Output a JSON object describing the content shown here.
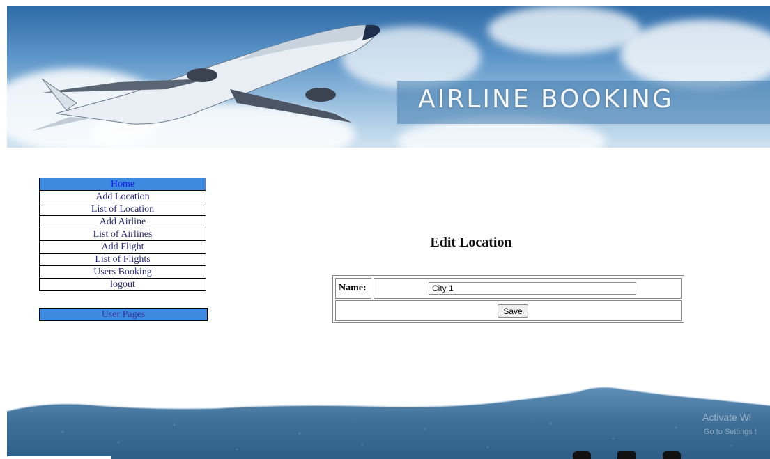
{
  "banner": {
    "title": "AIRLINE BOOKING"
  },
  "menu": {
    "items": [
      {
        "label": "Home"
      },
      {
        "label": "Add Location"
      },
      {
        "label": "List of Location"
      },
      {
        "label": "Add Airline"
      },
      {
        "label": "List of Airlines"
      },
      {
        "label": "Add Flight"
      },
      {
        "label": "List of Flights"
      },
      {
        "label": "Users Booking"
      },
      {
        "label": "logout"
      }
    ],
    "user_pages": "User Pages"
  },
  "form": {
    "title": "Edit Location",
    "name_label": "Name:",
    "name_value": "City 1",
    "save_label": "Save"
  },
  "watermark": {
    "line1": "Activate Wi",
    "line2": "Go to Settings t"
  },
  "footer": {
    "social_icons": [
      "twitter-icon",
      "facebook-icon",
      "instagram-icon"
    ]
  },
  "colors": {
    "menu_highlight": "#3d8be0",
    "footer_paint": "#3f6f97"
  }
}
